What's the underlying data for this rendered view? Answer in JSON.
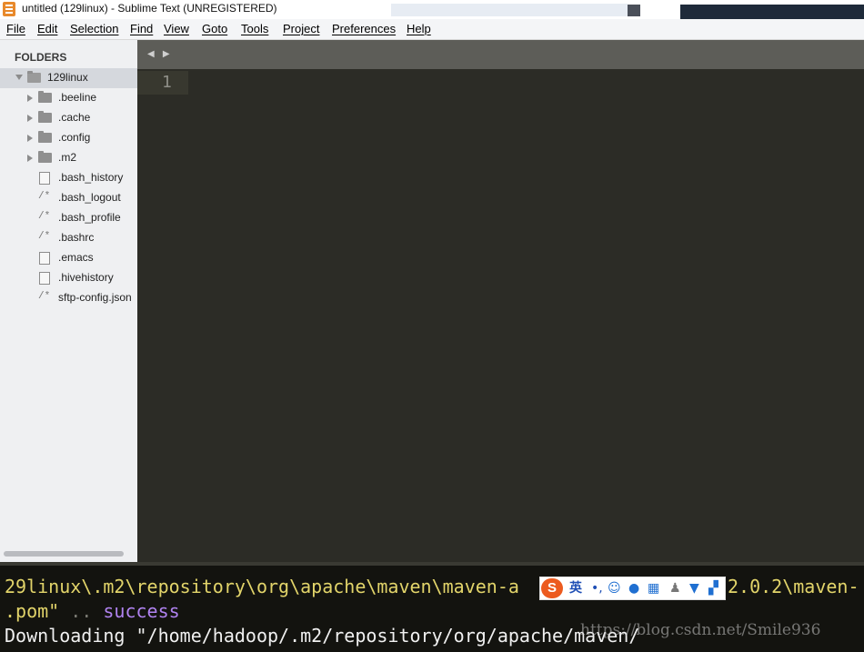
{
  "window": {
    "title": "untitled (129linux) - Sublime Text (UNREGISTERED)"
  },
  "menu": [
    "File",
    "Edit",
    "Selection",
    "Find",
    "View",
    "Goto",
    "Tools",
    "Project",
    "Preferences",
    "Help"
  ],
  "sidebar": {
    "header": "FOLDERS",
    "root": "129linux",
    "items": [
      {
        "label": ".beeline",
        "type": "folder"
      },
      {
        "label": ".cache",
        "type": "folder"
      },
      {
        "label": ".config",
        "type": "folder"
      },
      {
        "label": ".m2",
        "type": "folder"
      },
      {
        "label": ".bash_history",
        "type": "file"
      },
      {
        "label": ".bash_logout",
        "type": "comment-file"
      },
      {
        "label": ".bash_profile",
        "type": "comment-file"
      },
      {
        "label": ".bashrc",
        "type": "comment-file"
      },
      {
        "label": ".emacs",
        "type": "file"
      },
      {
        "label": ".hivehistory",
        "type": "file"
      },
      {
        "label": "sftp-config.json",
        "type": "comment-file"
      }
    ],
    "comment_glyph": "/*"
  },
  "editor": {
    "line_number": "1",
    "tab_nav": "◀ ▶"
  },
  "terminal": {
    "line1_left": "29linux\\.m2\\repository\\org\\apache\\maven\\maven-a",
    "line1_right": "2.0.2\\maven-",
    "line2_a": ".pom\"",
    "line2_b": " .. ",
    "line2_c": "success",
    "line3": "Downloading \"/home/hadoop/.m2/repository/org/apache/maven/"
  },
  "ime": {
    "logo": "S",
    "lang": "英"
  },
  "watermark": "https://blog.csdn.net/Smile936",
  "colors": {
    "editor_bg": "#2c2c26",
    "sidebar_bg": "#eff0f2",
    "terminal_yellow": "#e2d46a",
    "terminal_purple": "#b083f0"
  }
}
